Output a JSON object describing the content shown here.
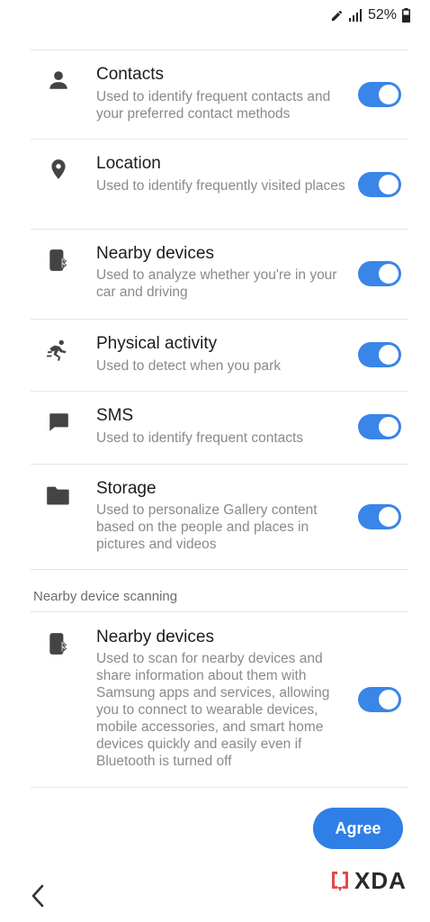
{
  "status_bar": {
    "battery_percent": "52%",
    "icons": [
      "pencil-icon",
      "signal-icon",
      "battery-icon"
    ]
  },
  "permissions": [
    {
      "title": "Contacts",
      "description": "Used to identify frequent contacts and your preferred contact methods",
      "icon": "person-icon",
      "enabled": true
    },
    {
      "title": "Location",
      "description": "Used to identify frequently visited places",
      "icon": "location-pin-icon",
      "enabled": true
    },
    {
      "title": "Nearby devices",
      "description": "Used to analyze whether you're in your car and driving",
      "icon": "nearby-devices-icon",
      "enabled": true
    },
    {
      "title": "Physical activity",
      "description": "Used to detect when you park",
      "icon": "running-person-icon",
      "enabled": true
    },
    {
      "title": "SMS",
      "description": "Used to identify frequent contacts",
      "icon": "message-icon",
      "enabled": true
    },
    {
      "title": "Storage",
      "description": "Used to personalize Gallery content based on the people and places in pictures and videos",
      "icon": "folder-icon",
      "enabled": true
    }
  ],
  "scanning_section": {
    "header": "Nearby device scanning",
    "item": {
      "title": "Nearby devices",
      "description": "Used to scan for nearby devices and share information about them with Samsung apps and services, allowing you to connect to wearable devices, mobile accessories, and smart home devices quickly and easily even if Bluetooth is turned off",
      "icon": "nearby-devices-icon",
      "enabled": true
    }
  },
  "actions": {
    "agree_label": "Agree",
    "back_icon": "chevron-left-icon"
  },
  "watermark": {
    "text": "XDA",
    "icon": "xda-logo-icon"
  },
  "colors": {
    "accent": "#3a85e8",
    "button": "#2f7fe6",
    "title_text": "#1c1c1c",
    "description_text": "#8a8a8a"
  }
}
